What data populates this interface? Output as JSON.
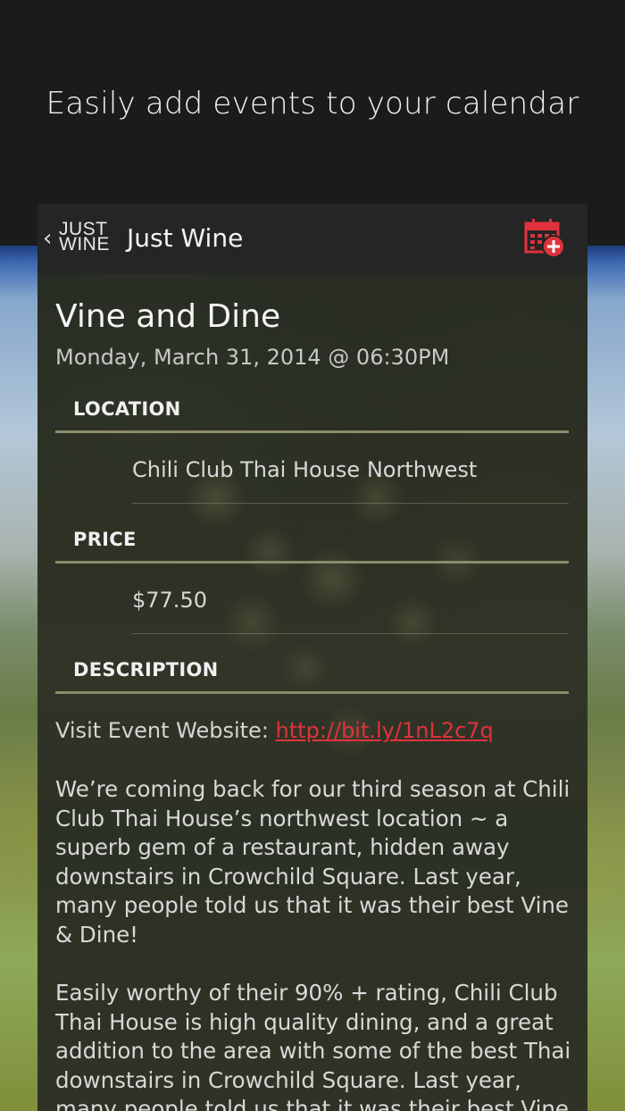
{
  "promo": {
    "headline": "Easily add events to your calendar"
  },
  "actionbar": {
    "back_glyph": "‹",
    "logo_line1": "JUST",
    "logo_line2": "WINE",
    "title": "Just Wine",
    "add_to_calendar_icon": "calendar-add-icon",
    "accent": "#e0323c"
  },
  "event": {
    "title": "Vine and Dine",
    "date": "Monday, March 31, 2014 @ 06:30PM"
  },
  "sections": {
    "location_header": "LOCATION",
    "location_value": "Chili Club Thai House Northwest",
    "price_header": "PRICE",
    "price_value": "$77.50",
    "description_header": "DESCRIPTION"
  },
  "description": {
    "website_label": "Visit Event Website: ",
    "website_link": "http://bit.ly/1nL2c7q",
    "paragraph1": "We’re coming back for our third season at Chili Club Thai House’s northwest location ~ a superb gem of a restaurant, hidden away downstairs in Crowchild Square. Last year, many people told us that it was their best Vine & Dine!",
    "paragraph2": "Easily worthy of their 90% + rating, Chili Club Thai House is high quality dining, and a great addition to the area with some of the best Thai downstairs in Crowchild Square. Last year, many people told us that it was their best Vine"
  }
}
